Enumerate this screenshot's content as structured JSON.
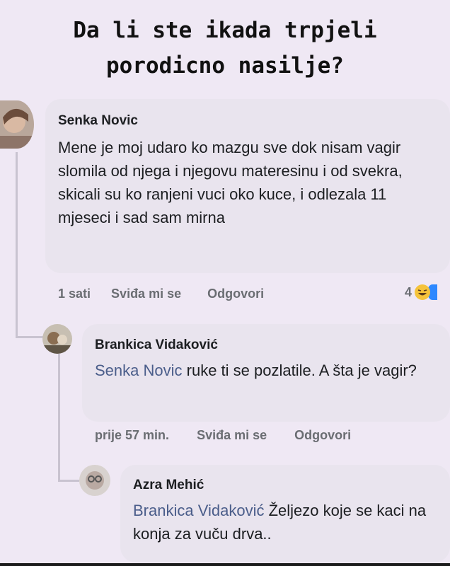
{
  "title": {
    "line1": "Da li ste ikada trpjeli",
    "line2": "porodicno nasilje?"
  },
  "comments": [
    {
      "author": "Senka Novic",
      "text": "Mene je moj udaro ko mazgu sve dok nisam vagir slomila od njega i njegovu materesinu i od svekra, skicali su ko ranjeni vuci oko kuce, i odlezala 11 mjeseci i sad sam mirna",
      "time": "1 sati",
      "like_label": "Sviđa mi se",
      "reply_label": "Odgovori",
      "reaction_count": "4",
      "avatar_icon": "user-photo-icon"
    },
    {
      "author": "Brankica Vidaković",
      "mention": "Senka Novic",
      "text": " ruke ti se pozlatile. A šta je vagir?",
      "time": "prije 57 min.",
      "like_label": "Sviđa mi se",
      "reply_label": "Odgovori",
      "avatar_icon": "user-photo-icon"
    },
    {
      "author": "Azra Mehić",
      "mention": "Brankica Vidaković",
      "text": " Željezo koje se kaci na konja za vuču drva..",
      "avatar_icon": "user-photo-icon"
    }
  ],
  "colors": {
    "background": "#efe8f4",
    "bubble": "#e9e4ee",
    "mention": "#4a5d8a",
    "meta": "#6a6d72"
  }
}
